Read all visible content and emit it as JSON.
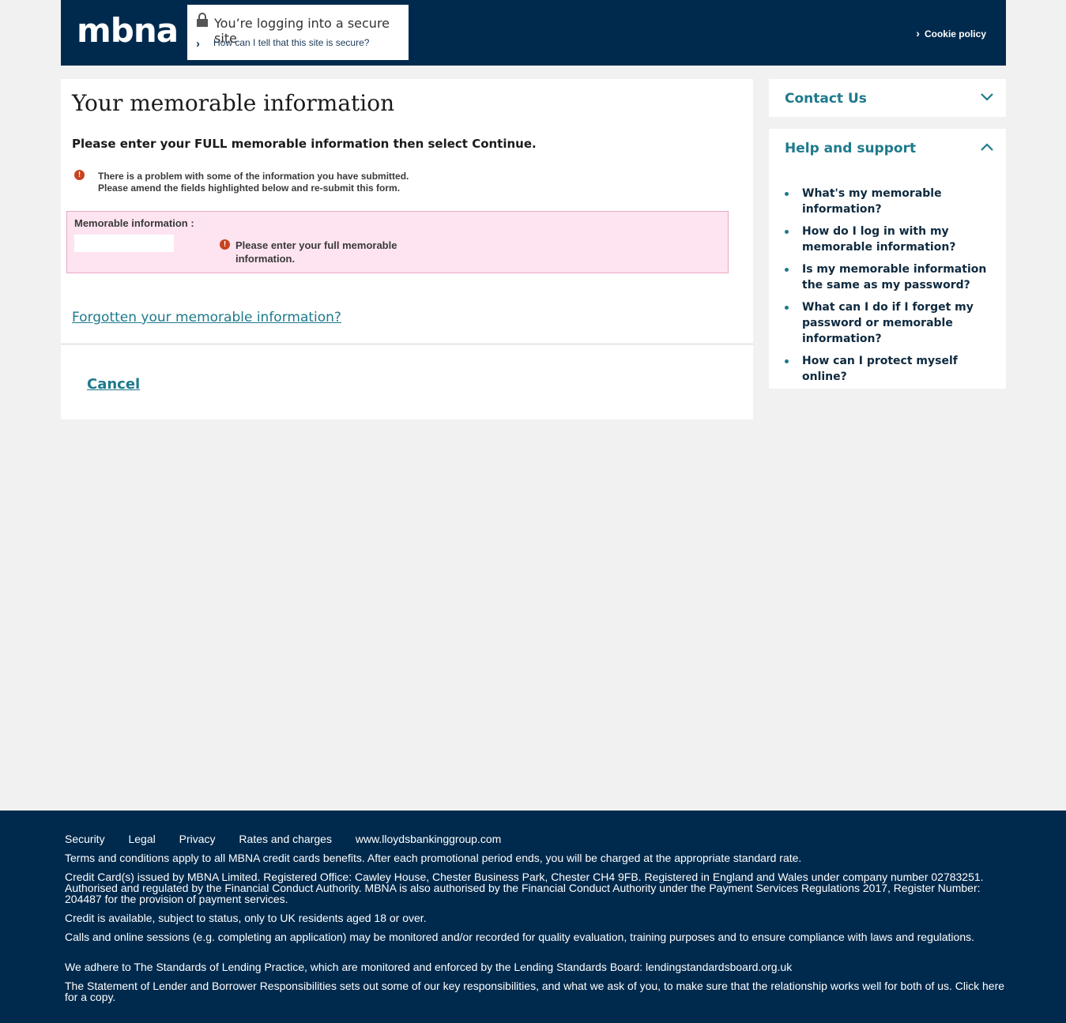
{
  "header": {
    "logo": "mbna",
    "secure_title": "You’re logging into a secure site",
    "secure_link": "How can I tell that this site is secure?",
    "cookie_policy": "Cookie policy"
  },
  "main": {
    "title": "Your memorable information",
    "instruction": "Please enter  your FULL memorable information then select Continue.",
    "error_line1": "There is a problem with some of the information you have submitted.",
    "error_line2": "Please amend the fields highlighted below and re-submit this form.",
    "field_label": "Memorable information :",
    "field_value": "",
    "field_error": "Please enter your full memorable information.",
    "forgot_link": "Forgotten your memorable information?",
    "cancel": "Cancel"
  },
  "sidebar": {
    "contact_heading": "Contact Us",
    "help_heading": "Help and support",
    "help_items": [
      "What's my memorable information?",
      "How do I log in with my memorable information?",
      "Is my memorable information the same as my password?",
      "What can I do if I forget my password or memorable information?",
      "How can I protect myself online?"
    ]
  },
  "footer": {
    "links": [
      "Security",
      "Legal",
      "Privacy",
      "Rates and charges",
      "www.lloydsbankinggroup.com"
    ],
    "p1": "Terms and conditions apply to all MBNA credit cards benefits. After each promotional period ends, you will be charged at the appropriate standard rate.",
    "p2": "Credit Card(s) issued by MBNA Limited. Registered Office: Cawley House, Chester Business Park, Chester CH4 9FB. Registered in England and Wales under company number 02783251. Authorised and regulated by the Financial Conduct Authority. MBNA is also authorised by the Financial Conduct Authority under the Payment Services Regulations 2017, Register Number: 204487 for the provision of payment services.",
    "p3": "Credit is available, subject to status, only to UK residents aged 18 or over.",
    "p4": "Calls and online sessions (e.g. completing an application) may be monitored and/or recorded for quality evaluation, training purposes and to ensure compliance with laws and regulations.",
    "p5": "We adhere to The Standards of Lending Practice, which are monitored and enforced by the Lending Standards Board: lendingstandardsboard.org.uk",
    "p6": "The Statement of Lender and Borrower Responsibilities sets out some of our key responsibilities, and what we ask of you, to make sure that the relationship works well for both of us. Click here for a copy."
  },
  "colors": {
    "navy": "#002a4d",
    "teal": "#1e7a8c",
    "error": "#c8421e",
    "error_bg": "#fde4f0"
  },
  "icons": [
    "lock-icon",
    "chevron-right-icon",
    "error-icon",
    "chevron-down-icon",
    "chevron-up-icon"
  ]
}
